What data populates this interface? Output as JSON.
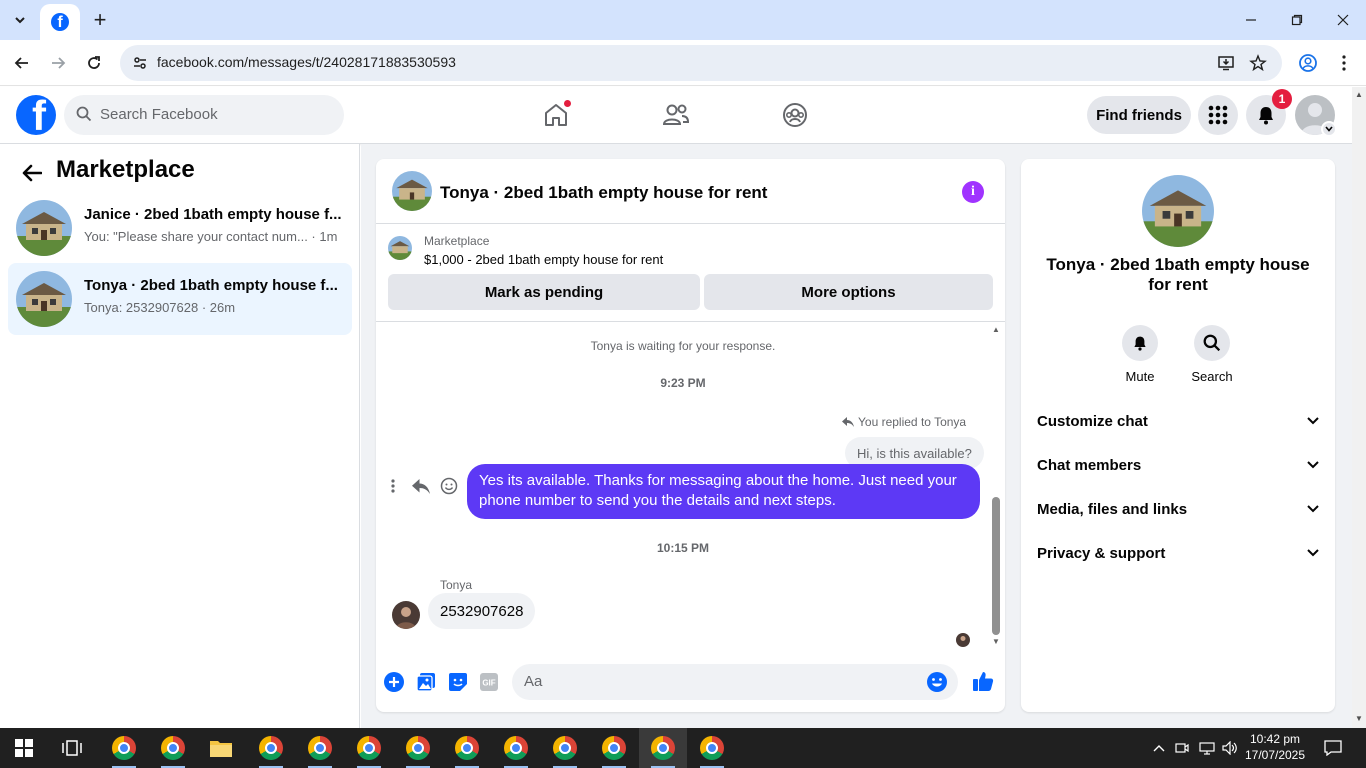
{
  "browser": {
    "url": "facebook.com/messages/t/24028171883530593"
  },
  "header": {
    "search_placeholder": "Search Facebook",
    "find_friends_label": "Find friends",
    "notification_count": "1"
  },
  "left_pane": {
    "title": "Marketplace",
    "conversations": [
      {
        "title": "Janice · 2bed 1bath empty house f...",
        "subtitle": "You: \"Please share your contact num... · 1m",
        "active": false
      },
      {
        "title": "Tonya · 2bed 1bath empty house f...",
        "subtitle": "Tonya: 2532907628 · 26m",
        "active": true
      }
    ]
  },
  "chat": {
    "title": "Tonya · 2bed 1bath empty house for rent",
    "listing": {
      "source": "Marketplace",
      "title": "$1,000 - 2bed 1bath empty house for rent",
      "mark_pending_label": "Mark as pending",
      "more_options_label": "More options"
    },
    "waiting_note": "Tonya is waiting for your response.",
    "time_1": "9:23 PM",
    "replied_note": "You replied to Tonya",
    "quoted_message": "Hi, is this available?",
    "outgoing_message": "Yes its available. Thanks for messaging about the home. Just need your phone number to send you the details and next steps.",
    "time_2": "10:15 PM",
    "sender_name": "Tonya",
    "incoming_message": "2532907628",
    "composer_placeholder": "Aa"
  },
  "right_pane": {
    "title": "Tonya · 2bed 1bath empty house for rent",
    "mute_label": "Mute",
    "search_label": "Search",
    "sections": [
      "Customize chat",
      "Chat members",
      "Media, files and links",
      "Privacy & support"
    ]
  },
  "taskbar": {
    "time": "10:42 pm",
    "date": "17/07/2025"
  },
  "colors": {
    "facebook_blue": "#0866ff",
    "outgoing_bubble": "#5d39f5",
    "info_purple": "#a033ff",
    "notification_red": "#e41e3f"
  }
}
